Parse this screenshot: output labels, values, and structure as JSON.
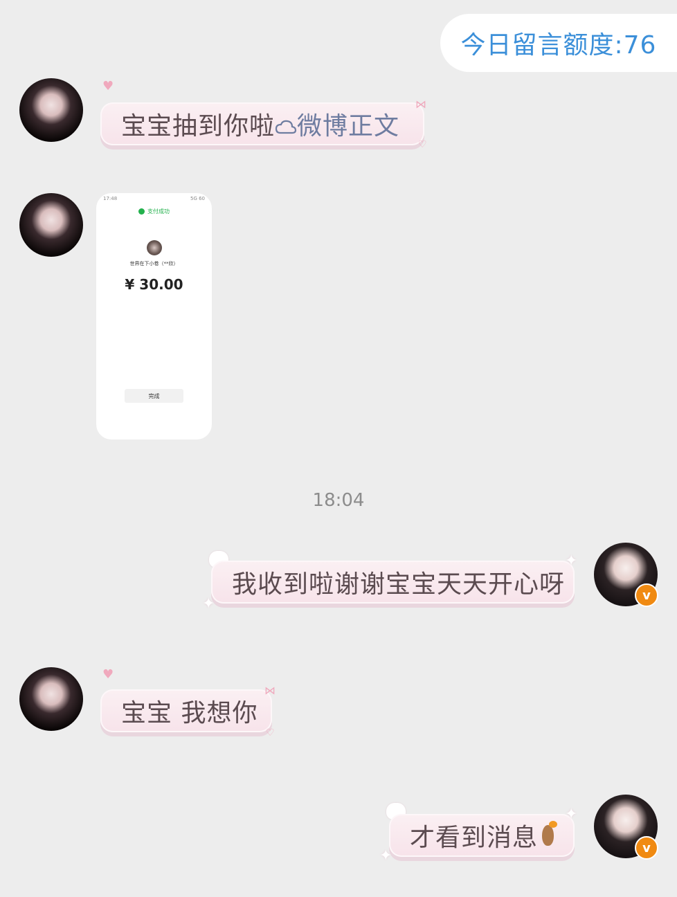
{
  "quota": {
    "label": "今日留言额度:76"
  },
  "messages": [
    {
      "side": "left",
      "text": "宝宝抽到你啦",
      "link_icon": "cloud-icon",
      "link_text": "微博正文"
    },
    {
      "side": "left",
      "type": "image",
      "screenshot": {
        "status_left": "17:48",
        "status_right": "5G 60",
        "success": "支付成功",
        "payee": "世界在下小卷（**欣）",
        "amount": "¥ 30.00",
        "done": "完成"
      }
    },
    {
      "side": "right",
      "text": "我收到啦谢谢宝宝天天开心呀"
    },
    {
      "side": "left",
      "text": "宝宝 我想你"
    },
    {
      "side": "right",
      "text": "才看到消息",
      "emoji": "capybara-orange-icon"
    }
  ],
  "timestamp": "18:04",
  "badge": {
    "label": "v",
    "color": "#f08a12"
  },
  "colors": {
    "quota_text": "#3b8fd9",
    "bubble": "#f7e3ea",
    "link": "#6e7ca0",
    "background": "#ededed"
  }
}
